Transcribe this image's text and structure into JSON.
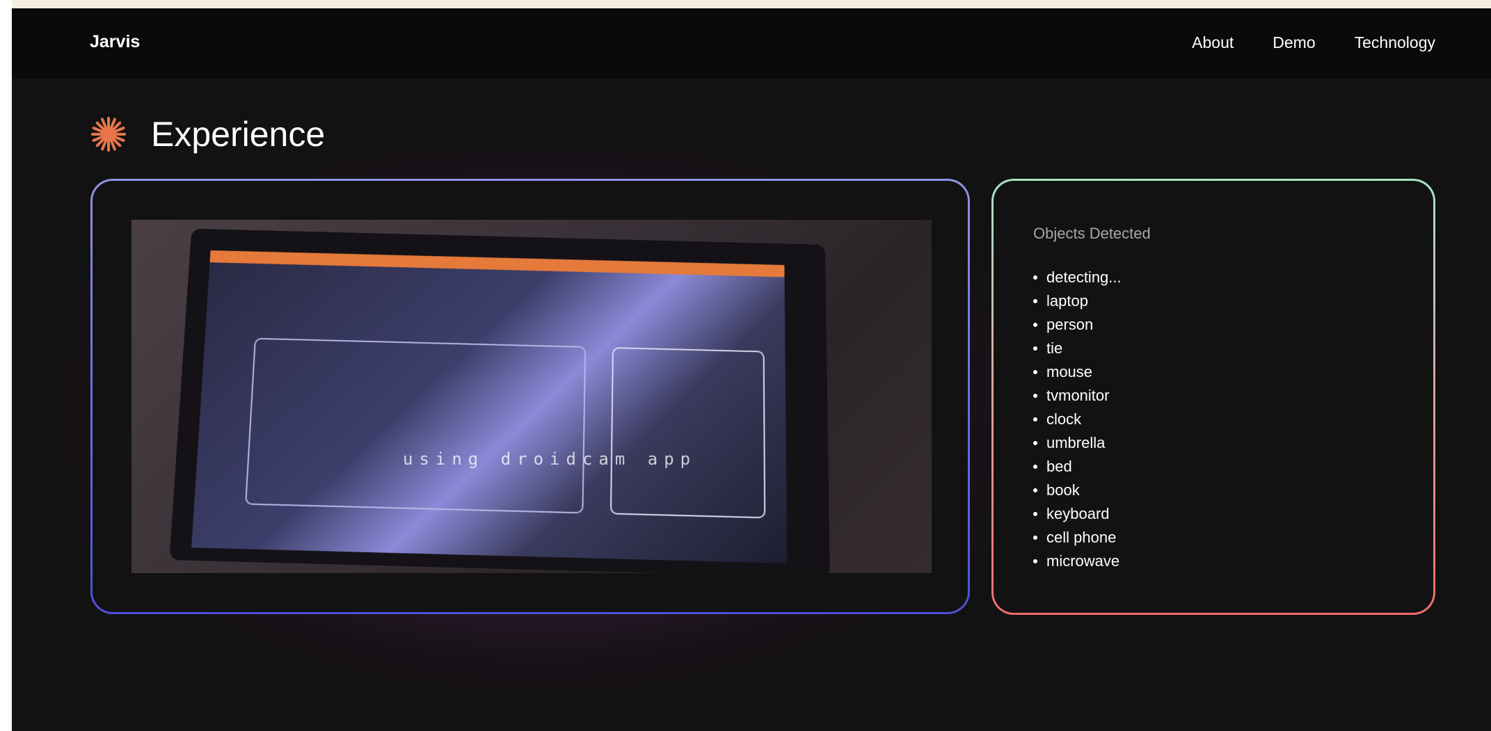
{
  "nav": {
    "brand": "Jarvis",
    "links": [
      "About",
      "Demo",
      "Technology"
    ]
  },
  "page": {
    "title": "Experience",
    "title_icon": "asterisk-star-icon",
    "accent_color": "#e8764a"
  },
  "video": {
    "overlay_text": "using droidcam app"
  },
  "objects": {
    "heading": "Objects Detected",
    "items": [
      "detecting...",
      "laptop",
      "person",
      "tie",
      "mouse",
      "tvmonitor",
      "clock",
      "umbrella",
      "bed",
      "book",
      "keyboard",
      "cell phone",
      "microwave"
    ]
  },
  "colors": {
    "background": "#121212",
    "navbar": "#0a0a0a",
    "video_border": "#6b6fe0",
    "objects_border_top": "#a7e3c2",
    "objects_border_bottom": "#f06a6a"
  }
}
